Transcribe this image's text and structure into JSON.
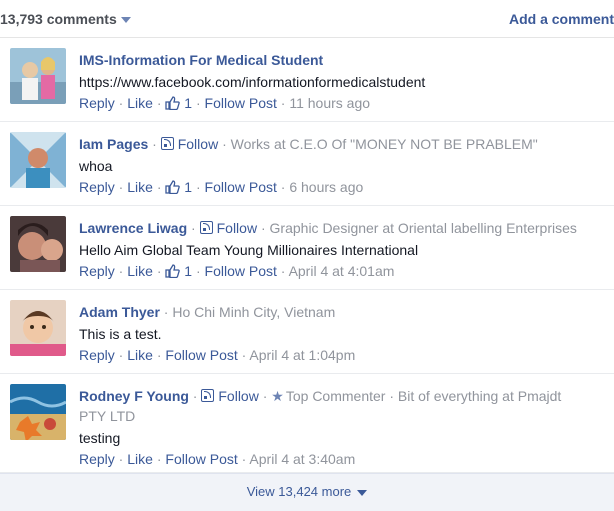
{
  "header": {
    "count_label": "13,793 comments",
    "add_comment": "Add a comment"
  },
  "labels": {
    "reply": "Reply",
    "like": "Like",
    "follow_post": "Follow Post",
    "follow": "Follow",
    "sep": " · "
  },
  "comments": [
    {
      "name": "IMS-Information For Medical Student",
      "text": "https://www.facebook.com/informationformedicalstudent",
      "likes": "1",
      "time": "11 hours ago"
    },
    {
      "name": "Iam Pages",
      "meta": "Works at C.E.O Of \"MONEY NOT BE PRABLEM\"",
      "text": "whoa",
      "likes": "1",
      "time": "6 hours ago"
    },
    {
      "name": "Lawrence Liwag",
      "meta": "Graphic Designer at Oriental labelling Enterprises",
      "text": "Hello Aim Global Team Young Millionaires International",
      "likes": "1",
      "time": "April 4 at 4:01am"
    },
    {
      "name": "Adam Thyer",
      "meta": "Ho Chi Minh City, Vietnam",
      "text": "This is a test.",
      "time": "April 4 at 1:04pm"
    },
    {
      "name": "Rodney F Young",
      "badge": "Top Commenter",
      "meta": "Bit of everything at Pmajdt PTY LTD",
      "text": "testing",
      "time": "April 4 at 3:40am"
    }
  ],
  "footer": {
    "view_more": "View 13,424 more"
  },
  "colors": {
    "link": "#3b5998",
    "muted": "#90949c",
    "footer_bg": "#f1f3f8"
  }
}
